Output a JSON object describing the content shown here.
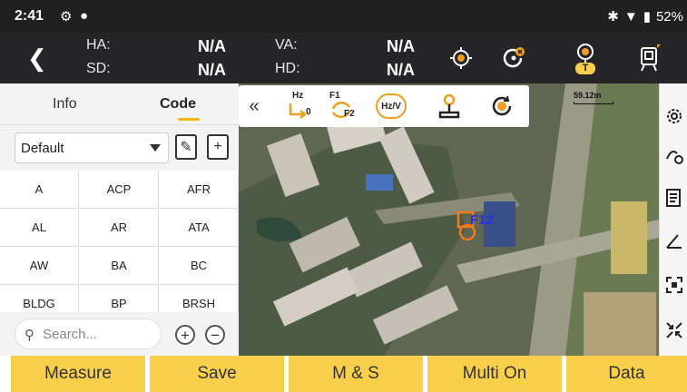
{
  "status_bar": {
    "time": "2:41",
    "battery": "52%"
  },
  "header": {
    "ha_label": "HA:",
    "ha_value": "N/A",
    "sd_label": "SD:",
    "sd_value": "N/A",
    "va_label": "VA:",
    "va_value": "N/A",
    "hd_label": "HD:",
    "hd_value": "N/A",
    "t_badge": "T"
  },
  "left_panel": {
    "tabs": [
      {
        "label": "Info",
        "active": false
      },
      {
        "label": "Code",
        "active": true
      }
    ],
    "layer_select": "Default",
    "codes": [
      "A",
      "ACP",
      "AFR",
      "AL",
      "AR",
      "ATA",
      "AW",
      "BA",
      "BC",
      "BLDG",
      "BP",
      "BRSH"
    ],
    "search_placeholder": "Search..."
  },
  "map": {
    "scale_label": "59.12m",
    "point_label": "F12",
    "toolbar": {
      "hz_label": "Hz",
      "hz_zero": "0",
      "f1_label": "F1",
      "f2_label": "F2",
      "hzv_label": "Hz/V"
    }
  },
  "bottom_bar": {
    "measure": "Measure",
    "save": "Save",
    "ms": "M & S",
    "multi": "Multi On",
    "data": "Data"
  },
  "colors": {
    "accent": "#f7cf4a",
    "header_bg": "#252527",
    "target_orange": "#f0a020",
    "point_blue": "#2a2ae0"
  }
}
